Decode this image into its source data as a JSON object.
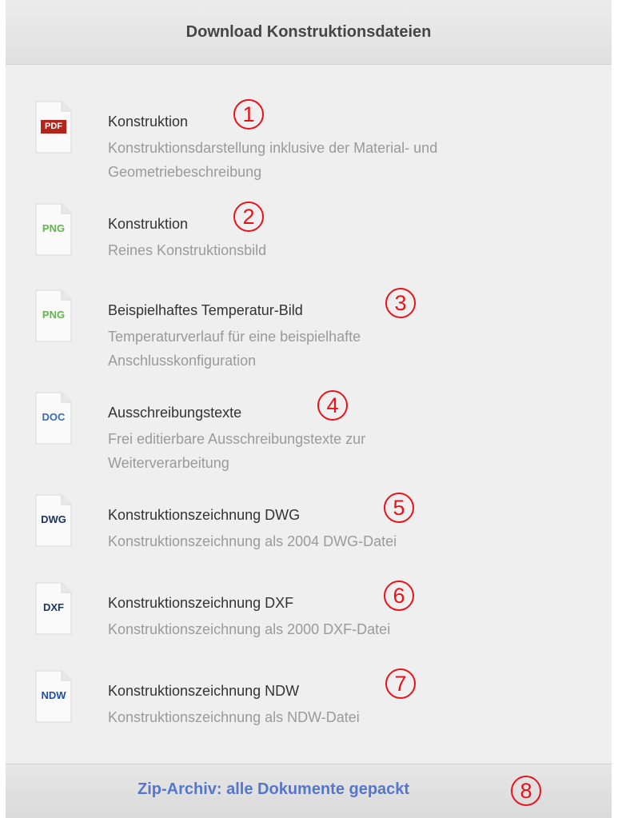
{
  "header": {
    "title": "Download Konstruktionsdateien"
  },
  "items": [
    {
      "type": "PDF",
      "type_color": "#ffffff",
      "title": "Konstruktion",
      "desc_line1": "Konstruktionsdarstellung inklusive der Material- und",
      "desc_line2": "Geometriebeschreibung",
      "marker": "1"
    },
    {
      "type": "PNG",
      "type_color": "#5cba46",
      "title": "Konstruktion",
      "desc_line1": "Reines Konstruktionsbild",
      "desc_line2": "",
      "marker": "2"
    },
    {
      "type": "PNG",
      "type_color": "#5cba46",
      "title": "Beispielhaftes Temperatur-Bild",
      "desc_line1": "Temperaturverlauf für eine beispielhafte",
      "desc_line2": "Anschlusskonfiguration",
      "marker": "3"
    },
    {
      "type": "DOC",
      "type_color": "#3a6bb6",
      "title": "Ausschreibungstexte",
      "desc_line1": "Frei editierbare Ausschreibungstexte zur",
      "desc_line2": "Weiterverarbeitung",
      "marker": "4"
    },
    {
      "type": "DWG",
      "type_color": "#1d3463",
      "title": "Konstruktionszeichnung DWG",
      "desc_line1": "Konstruktionszeichnung als 2004 DWG-Datei",
      "desc_line2": "",
      "marker": "5"
    },
    {
      "type": "DXF",
      "type_color": "#1d3463",
      "title": "Konstruktionszeichnung DXF",
      "desc_line1": "Konstruktionszeichnung als 2000 DXF-Datei",
      "desc_line2": "",
      "marker": "6"
    },
    {
      "type": "NDW",
      "type_color": "#1f4fa8",
      "title": "Konstruktionszeichnung NDW",
      "desc_line1": "Konstruktionszeichnung als NDW-Datei",
      "desc_line2": "",
      "marker": "7"
    }
  ],
  "footer": {
    "zip_label": "Zip-Archiv: alle Dokumente gepackt",
    "marker": "8"
  },
  "colors": {
    "marker": "#e8131a",
    "link": "#5576c9",
    "pdf_badge": "#b3241d"
  }
}
